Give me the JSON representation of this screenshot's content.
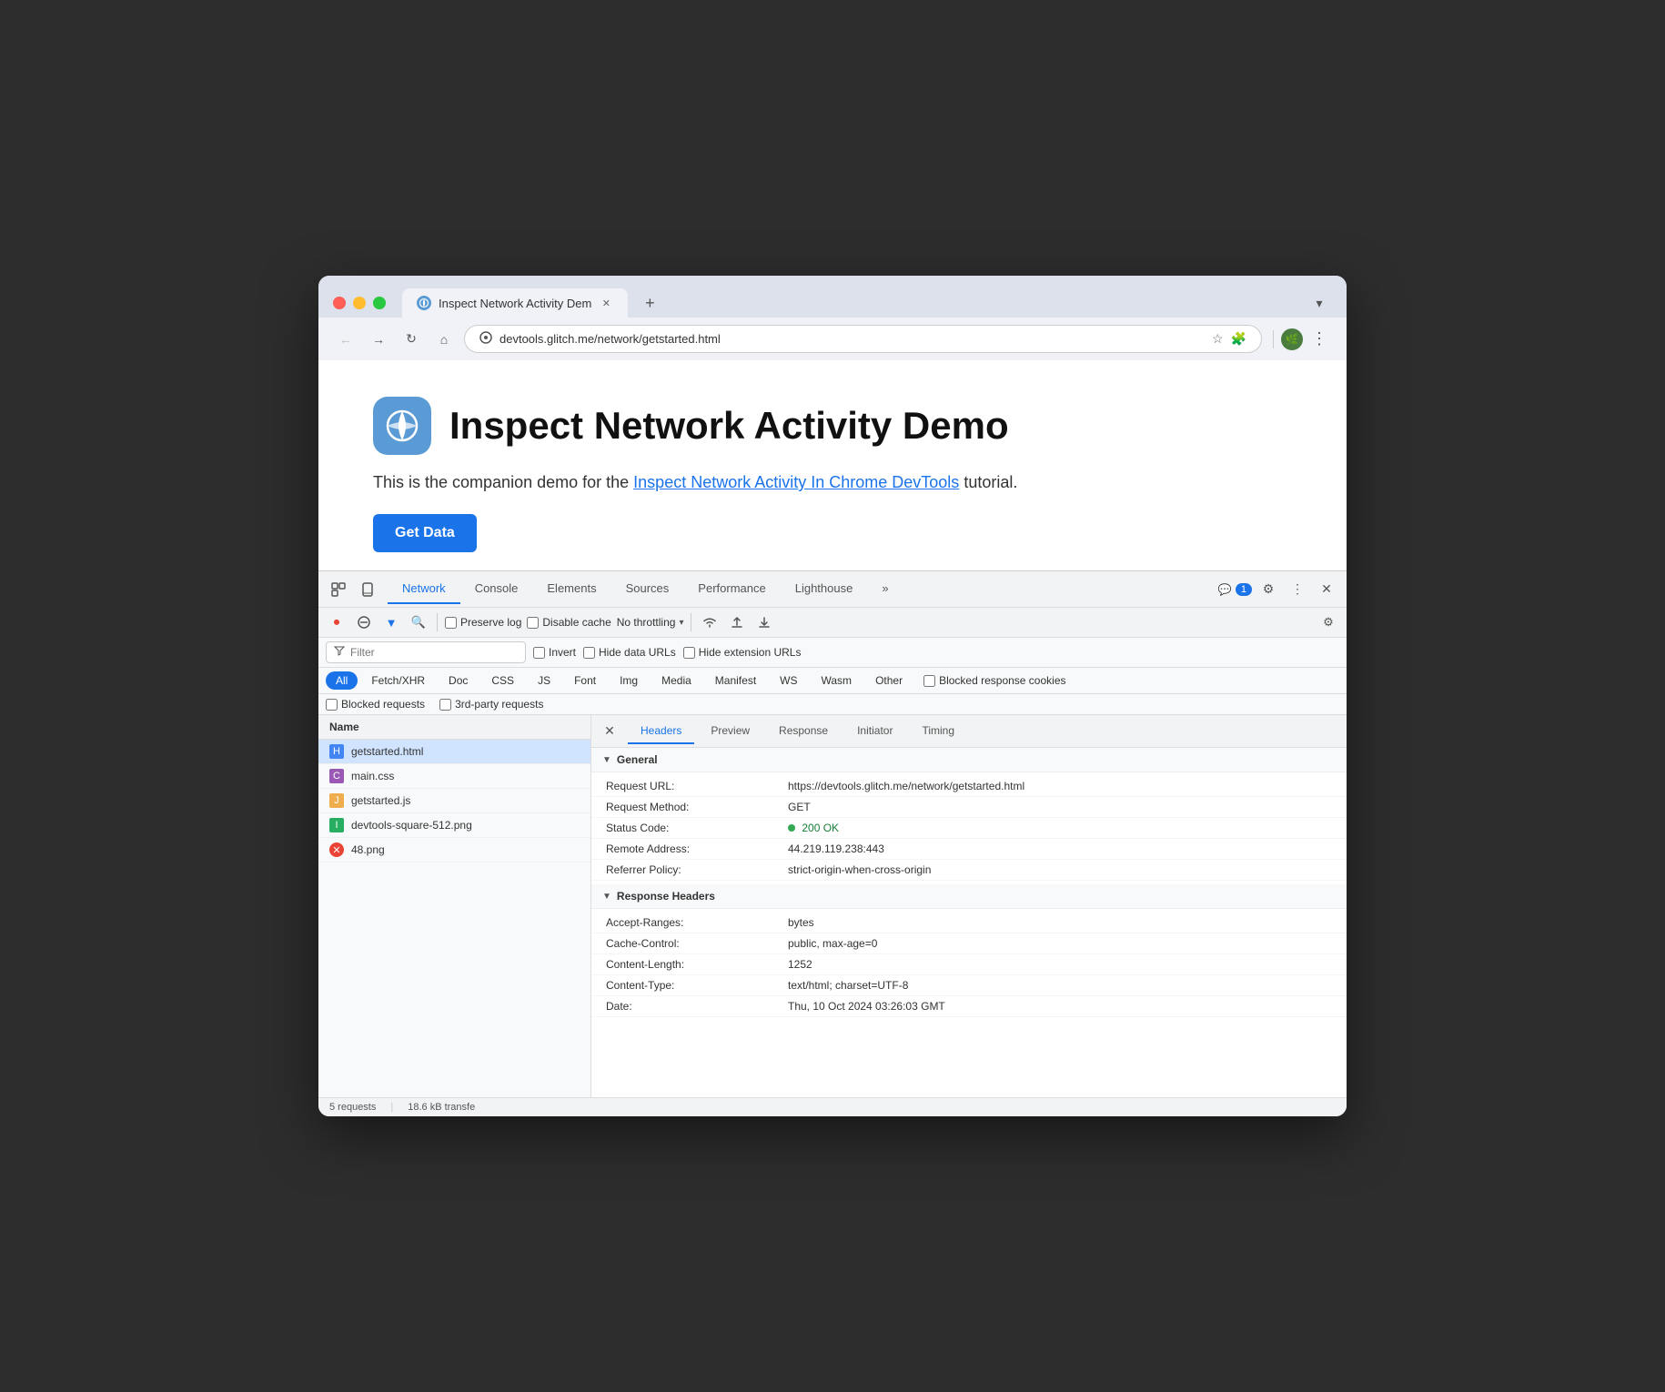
{
  "browser": {
    "tab_title": "Inspect Network Activity Dem",
    "tab_favicon": "🌐",
    "url": "devtools.glitch.me/network/getstarted.html",
    "dropdown_icon": "▾",
    "back_icon": "←",
    "forward_icon": "→",
    "refresh_icon": "↻",
    "home_icon": "⌂",
    "star_icon": "☆",
    "ext_icon": "🧩",
    "avatar_text": "🌿",
    "more_icon": "⋮"
  },
  "page": {
    "title": "Inspect Network Activity Demo",
    "subtitle_text": "This is the companion demo for the",
    "subtitle_link": "Inspect Network Activity In Chrome DevTools",
    "subtitle_end": "tutorial.",
    "btn_label": "Get Data"
  },
  "devtools": {
    "tabs": [
      {
        "label": "Elements",
        "active": false
      },
      {
        "label": "Console",
        "active": false
      },
      {
        "label": "Network",
        "active": true
      },
      {
        "label": "Sources",
        "active": false
      },
      {
        "label": "Performance",
        "active": false
      },
      {
        "label": "Lighthouse",
        "active": false
      },
      {
        "label": "»",
        "active": false
      }
    ],
    "badge_count": "1",
    "settings_icon": "⚙",
    "more_icon": "⋮",
    "close_icon": "✕",
    "insp_icon": "⬚",
    "device_icon": "📱"
  },
  "network_toolbar": {
    "record_icon": "⏺",
    "clear_icon": "🚫",
    "filter_icon": "▼",
    "search_icon": "🔍",
    "preserve_log": "Preserve log",
    "disable_cache": "Disable cache",
    "throttle_label": "No throttling",
    "wifi_icon": "📶",
    "import_icon": "⬆",
    "export_icon": "⬇",
    "settings_icon": "⚙"
  },
  "filter_row": {
    "filter_placeholder": "Filter",
    "funnel_icon": "⊎",
    "invert_label": "Invert",
    "hide_data_label": "Hide data URLs",
    "hide_ext_label": "Hide extension URLs"
  },
  "filter_types": {
    "types": [
      "All",
      "Fetch/XHR",
      "Doc",
      "CSS",
      "JS",
      "Font",
      "Img",
      "Media",
      "Manifest",
      "WS",
      "Wasm",
      "Other"
    ],
    "active": "All",
    "blocked_cookies_label": "Blocked response cookies"
  },
  "requests_row": {
    "blocked_label": "Blocked requests",
    "third_party_label": "3rd-party requests"
  },
  "network_list": {
    "header": "Name",
    "items": [
      {
        "name": "getstarted.html",
        "type": "html",
        "selected": true
      },
      {
        "name": "main.css",
        "type": "css",
        "selected": false
      },
      {
        "name": "getstarted.js",
        "type": "js",
        "selected": false
      },
      {
        "name": "devtools-square-512.png",
        "type": "img",
        "selected": false
      },
      {
        "name": "48.png",
        "type": "err",
        "selected": false
      }
    ]
  },
  "detail_panel": {
    "close_icon": "✕",
    "tabs": [
      "Headers",
      "Preview",
      "Response",
      "Initiator",
      "Timing"
    ],
    "active_tab": "Headers",
    "general_section": "General",
    "general_fields": [
      {
        "name": "Request URL:",
        "value": "https://devtools.glitch.me/network/getstarted.html"
      },
      {
        "name": "Request Method:",
        "value": "GET"
      },
      {
        "name": "Status Code:",
        "value": "200 OK",
        "is_status": true
      },
      {
        "name": "Remote Address:",
        "value": "44.219.119.238:443"
      },
      {
        "name": "Referrer Policy:",
        "value": "strict-origin-when-cross-origin"
      }
    ],
    "response_section": "Response Headers",
    "response_fields": [
      {
        "name": "Accept-Ranges:",
        "value": "bytes"
      },
      {
        "name": "Cache-Control:",
        "value": "public, max-age=0"
      },
      {
        "name": "Content-Length:",
        "value": "1252"
      },
      {
        "name": "Content-Type:",
        "value": "text/html; charset=UTF-8"
      },
      {
        "name": "Date:",
        "value": "Thu, 10 Oct 2024 03:26:03 GMT"
      }
    ]
  },
  "status_bar": {
    "requests": "5 requests",
    "transfer": "18.6 kB transfe"
  }
}
